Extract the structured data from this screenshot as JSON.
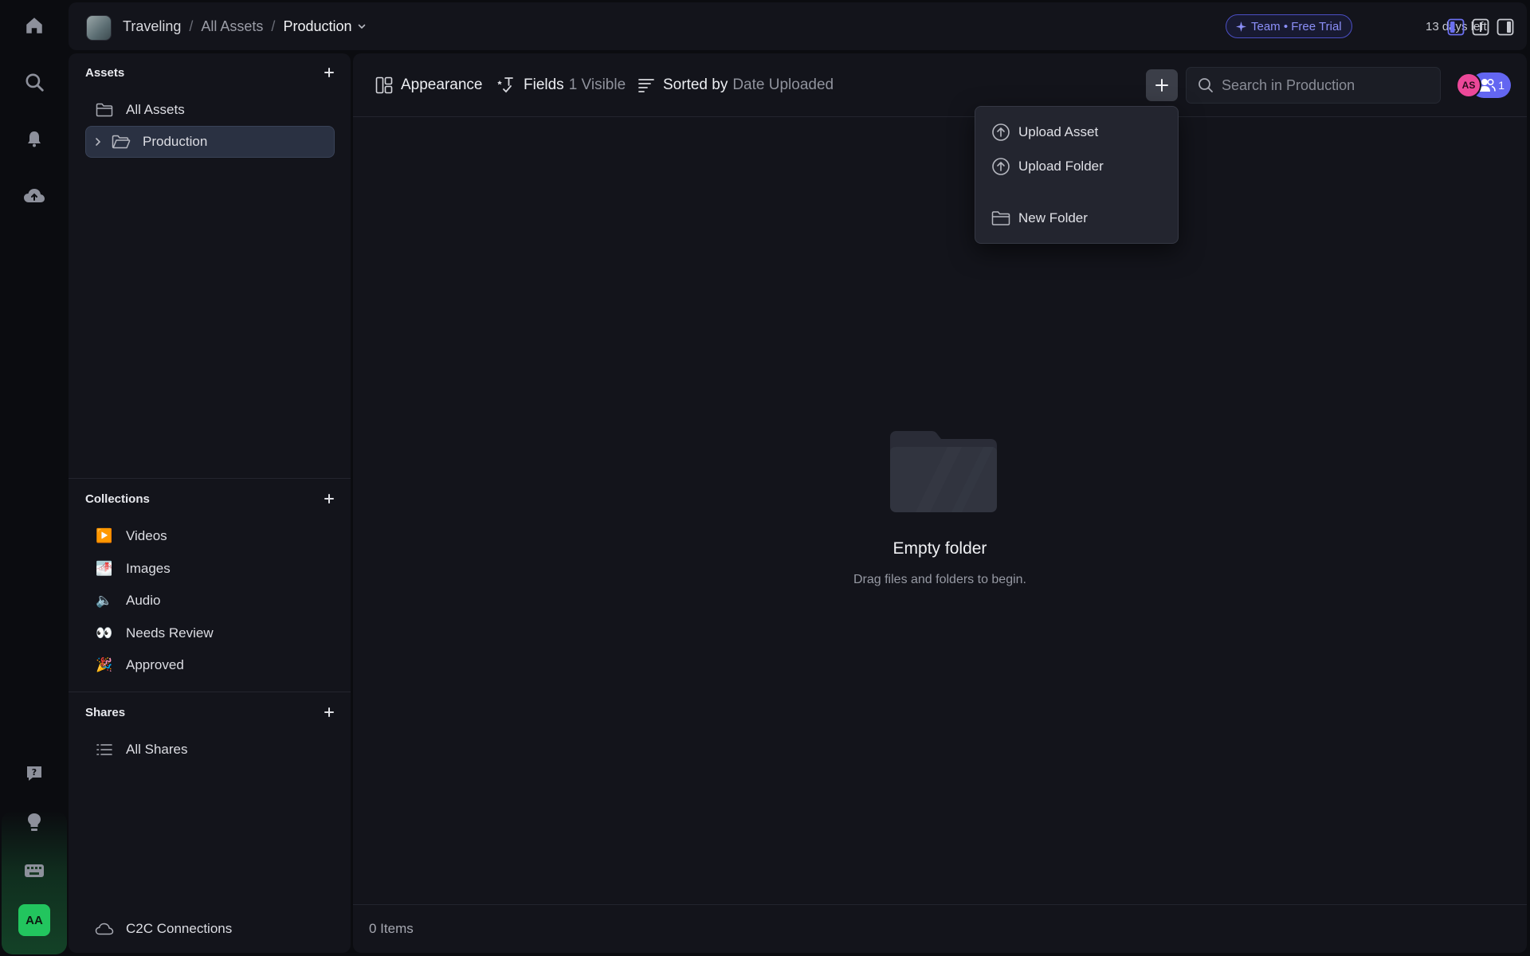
{
  "topbar": {
    "breadcrumb": [
      "Traveling",
      "All Assets",
      "Production"
    ],
    "breadcrumb_sep": "/",
    "trial_badge": "Team • Free Trial",
    "days_left": "13 days left"
  },
  "rail": {
    "icons": [
      "home-icon",
      "search-icon",
      "bell-icon",
      "cloud-upload-icon",
      "help-icon",
      "lightbulb-icon",
      "keyboard-icon"
    ],
    "user_initials": "AA"
  },
  "sidebar": {
    "assets": {
      "title": "Assets",
      "items": [
        {
          "label": "All Assets",
          "icon": "folder-icon"
        },
        {
          "label": "Production",
          "icon": "folder-open-icon",
          "selected": true
        }
      ]
    },
    "collections": {
      "title": "Collections",
      "items": [
        {
          "label": "Videos",
          "icon": "▶️"
        },
        {
          "label": "Images",
          "icon": "🌁"
        },
        {
          "label": "Audio",
          "icon": "🔈"
        },
        {
          "label": "Needs Review",
          "icon": "👀"
        },
        {
          "label": "Approved",
          "icon": "🎉"
        }
      ]
    },
    "shares": {
      "title": "Shares",
      "items": [
        {
          "label": "All Shares",
          "icon": "list-icon"
        }
      ]
    },
    "footer_item": {
      "label": "C2C Connections",
      "icon": "cloud-icon"
    }
  },
  "toolbar": {
    "appearance": "Appearance",
    "fields": "Fields",
    "fields_count": "1 Visible",
    "sorted_by": "Sorted by",
    "sorted_value": "Date Uploaded",
    "search_placeholder": "Search in Production",
    "user_initials": "AS",
    "members_count": "1"
  },
  "dropdown": {
    "items": [
      "Upload Asset",
      "Upload Folder",
      "New Folder"
    ]
  },
  "empty_state": {
    "title": "Empty folder",
    "subtitle": "Drag files and folders to begin."
  },
  "footer": {
    "item_count": "0 Items"
  },
  "colors": {
    "accent": "#6366f1",
    "trial_border": "#4b4fc4",
    "avatar_green": "#22c55e",
    "avatar_pink": "#ec4899",
    "panel_bg": "#13141b",
    "app_bg": "#0b0c10"
  }
}
